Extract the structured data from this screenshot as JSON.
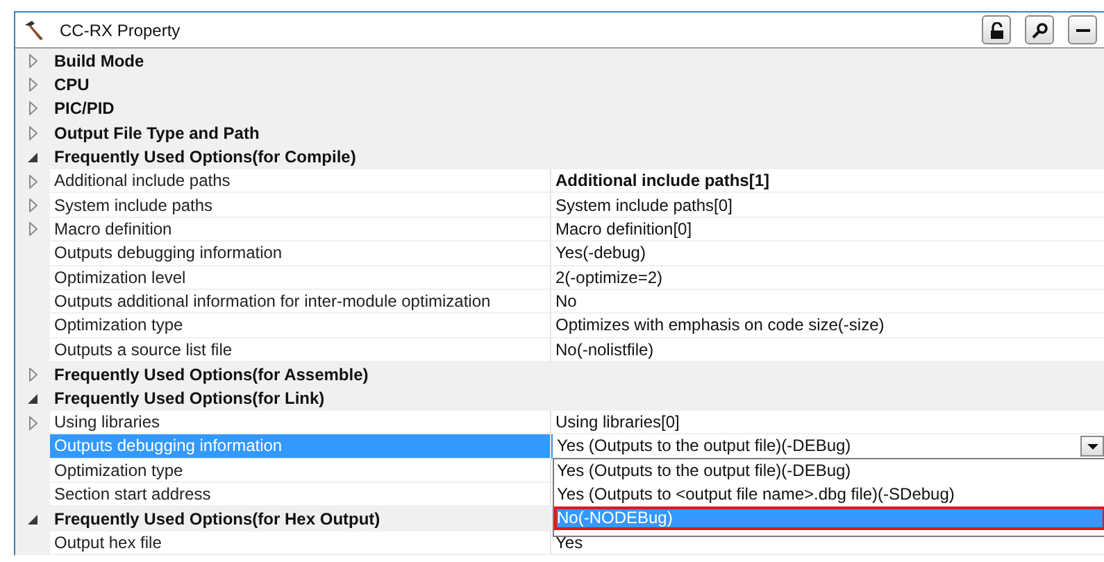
{
  "window": {
    "title": "CC-RX Property"
  },
  "toolbar": [
    {
      "kind": "lock"
    },
    {
      "kind": "search"
    },
    {
      "kind": "minimize"
    }
  ],
  "categories": [
    {
      "name": "Build Mode",
      "expanded": false
    },
    {
      "name": "CPU",
      "expanded": false
    },
    {
      "name": "PIC/PID",
      "expanded": false
    },
    {
      "name": "Output File Type and Path",
      "expanded": false
    },
    {
      "name": "Frequently Used Options(for Compile)",
      "expanded": true,
      "properties": [
        {
          "name": "Additional include paths",
          "value": "Additional include paths[1]",
          "modified": true,
          "selected": false,
          "expanded": false
        },
        {
          "name": "System include paths",
          "value": "System include paths[0]",
          "modified": false,
          "selected": false,
          "expanded": false
        },
        {
          "name": "Macro definition",
          "value": "Macro definition[0]",
          "modified": false,
          "selected": false,
          "expanded": false
        },
        {
          "name": "Outputs debugging information",
          "value": "Yes(-debug)",
          "modified": false,
          "selected": false
        },
        {
          "name": "Optimization level",
          "value": "2(-optimize=2)",
          "modified": false,
          "selected": false
        },
        {
          "name": "Outputs additional information for inter-module optimization",
          "value": "No",
          "modified": false,
          "selected": false
        },
        {
          "name": "Optimization type",
          "value": "Optimizes with emphasis on code size(-size)",
          "modified": false,
          "selected": false
        },
        {
          "name": "Outputs a source list file",
          "value": "No(-nolistfile)",
          "modified": false,
          "selected": false
        }
      ]
    },
    {
      "name": "Frequently Used Options(for Assemble)",
      "expanded": false
    },
    {
      "name": "Frequently Used Options(for Link)",
      "expanded": true,
      "properties": [
        {
          "name": "Using libraries",
          "value": "Using libraries[0]",
          "modified": false,
          "selected": false,
          "expanded": false
        },
        {
          "name": "Outputs debugging information",
          "value": "Yes (Outputs to the output file)(-DEBug)",
          "modified": false,
          "selected": true,
          "dropdown": {
            "options": [
              {
                "label": "Yes (Outputs to the output file)(-DEBug)",
                "selected": false
              },
              {
                "label": "Yes (Outputs to <output file name>.dbg file)(-SDebug)",
                "selected": false
              },
              {
                "label": "No(-NODEBug)",
                "selected": true
              }
            ]
          }
        },
        {
          "name": "Optimization type",
          "selected": false
        },
        {
          "name": "Section start address",
          "selected": false
        }
      ]
    },
    {
      "name": "Frequently Used Options(for Hex Output)",
      "expanded": true,
      "properties": [
        {
          "name": "Output hex file",
          "value": "Yes",
          "modified": false,
          "selected": false
        }
      ]
    }
  ]
}
